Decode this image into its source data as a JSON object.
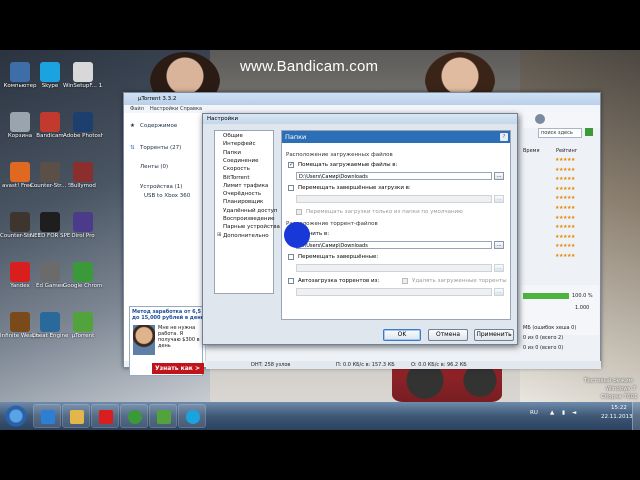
{
  "watermark": "www.Bandicam.com",
  "desktop_icons": [
    {
      "label": "Компьютер",
      "color": "#3d6ea8"
    },
    {
      "label": "Skype",
      "color": "#1ba3e0"
    },
    {
      "label": "WinSetupF... 1.0 beta6",
      "color": "#d8d8d8"
    },
    {
      "label": "Корзина",
      "color": "#9aa4ae"
    },
    {
      "label": "Bandicam",
      "color": "#c23a2e"
    },
    {
      "label": "Adobe Photosh...",
      "color": "#1d3f6e"
    },
    {
      "label": "avast! Free...",
      "color": "#e06820"
    },
    {
      "label": "Counter-Str... Source",
      "color": "#5a5048"
    },
    {
      "label": "Bullymod",
      "color": "#8a2e2e"
    },
    {
      "label": "Counter-Str... 1.6",
      "color": "#3e362e"
    },
    {
      "label": "NEED FOR SPEED H...",
      "color": "#1e1e1e"
    },
    {
      "label": "Dirol Pro",
      "color": "#4b3b8a"
    },
    {
      "label": "Yandex",
      "color": "#d81e1e"
    },
    {
      "label": "Ed Games",
      "color": "#6b6b6b"
    },
    {
      "label": "Google Chrome",
      "color": "#3a9a3a"
    },
    {
      "label": "Infinite Weapon...",
      "color": "#7a4a1a"
    },
    {
      "label": "Cheat Engine",
      "color": "#2a6a9a"
    },
    {
      "label": "µTorrent",
      "color": "#52a33b"
    }
  ],
  "utorrent": {
    "title": "µTorrent 3.3.2",
    "menu": [
      "Файл",
      "Настройки",
      "Справка"
    ],
    "sidebar": {
      "content": "Содержимое",
      "torrents": "Торренты (27)",
      "feeds": "Ленты (0)",
      "devices": "Устройства (1)",
      "device": "USB to Xbox 360"
    },
    "search_placeholder": "поиск здесь",
    "columns": {
      "time": "Время",
      "rating": "Рейтинг"
    },
    "rating_rows": 11,
    "progress_label": "100.0 %",
    "right_values": [
      "0.000",
      "1.000"
    ],
    "info_lines": [
      "МБ (ошибок хеша 0)",
      "0 из 0 (всего 2)",
      "0 из 0 (всего 0)"
    ],
    "status": {
      "dht": "DHT: 258 узлов",
      "download": "П: 0.0 КБ/с в: 157.3 КБ",
      "upload": "О: 0.0 КБ/с в: 96.2 КБ"
    },
    "ad": {
      "headline": "Метод заработка от 6,5 до 15,000 рублей в день",
      "text": "Мне не нужна работа. Я получаю $300 в день",
      "button": "Узнать как >"
    }
  },
  "settings": {
    "title": "Настройки",
    "tree": [
      "Общие",
      "Интерфейс",
      "Папки",
      "Соединение",
      "Скорость",
      "BitTorrent",
      "Лимит трафика",
      "Очерёдность",
      "Планировщик",
      "Удалённый доступ",
      "Воспроизведение",
      "Парные устройства",
      "Дополнительно"
    ],
    "panel_title": "Папки",
    "help": "?",
    "group_downloaded": "Расположение загруженных файлов",
    "put_downloads": "Помещать загружаемые файлы в:",
    "downloads_path": "D:\\Users\\Самир\\Downloads",
    "move_completed": "Перемещать завершённые загрузки в:",
    "only_default": "Перемещать загрузки только из папки по умолчанию",
    "group_torrents": "Расположение торрент-файлов",
    "store_torrents": "Хранить в:",
    "torrents_path": "D:\\Users\\Самир\\Downloads",
    "move_completed_torrents": "Перемещать завершённые:",
    "autoload": "Автозагрузка торрентов из:",
    "delete_loaded": "Удалять загруженные торренты",
    "browse": "...",
    "ok": "OK",
    "cancel": "Отмена",
    "apply": "Применить"
  },
  "taskbar": {
    "lang": "RU",
    "time": "15:22",
    "date": "22.11.2013",
    "windows_msg": [
      "Тестовый режим",
      "Windows 7",
      "Сборка 7601"
    ]
  }
}
